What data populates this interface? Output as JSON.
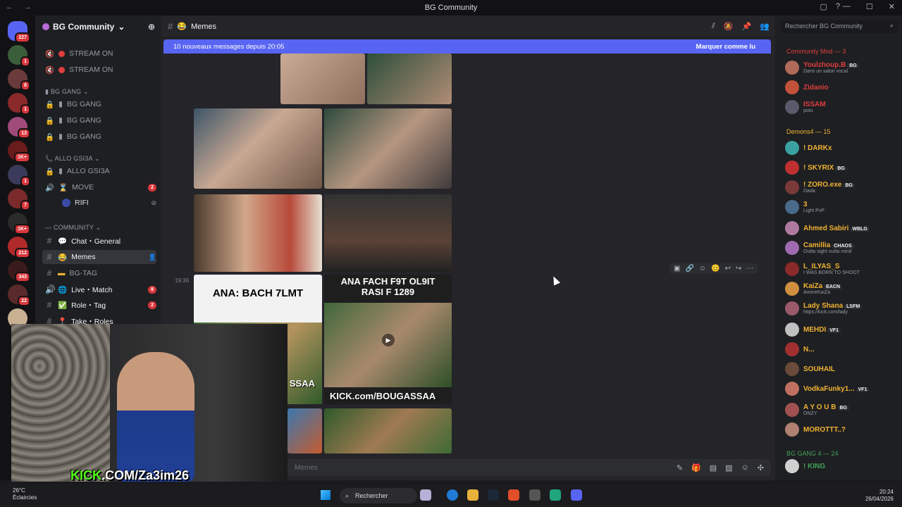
{
  "window": {
    "title": "BG Community"
  },
  "servers": [
    {
      "badge": "227"
    },
    {
      "badge": "1"
    },
    {
      "badge": "6"
    },
    {
      "badge": "1"
    },
    {
      "badge": "13"
    },
    {
      "badge": "1K+"
    },
    {
      "badge": "1"
    },
    {
      "badge": "7"
    },
    {
      "badge": "1K+"
    },
    {
      "badge": "212"
    },
    {
      "badge": "343"
    },
    {
      "badge": "22"
    },
    {
      "badge": ""
    }
  ],
  "guild": {
    "name": "BG Community"
  },
  "channels": {
    "stream1": "STREAM ON",
    "stream2": "STREAM ON",
    "cat_bg_gang": "BG GANG",
    "bg1": "BG GANG",
    "bg2": "BG GANG",
    "bg3": "BG GANG",
    "cat_allo": "ALLO GSI3A",
    "allo": "ALLO GSI3A",
    "move": "MOVE",
    "move_badge": "2",
    "rifi": "RIFI",
    "cat_community": "COMMUNITY",
    "chat": "Chat・General",
    "memes": "Memes",
    "bgtag": "BG-TAG",
    "live": "Live・Match",
    "live_badge": "8",
    "role": "Role・Tag",
    "role_badge": "2",
    "take": "Take・Roles"
  },
  "chat": {
    "channel_name": "Memes",
    "banner_text": "10 nouveaux messages depuis 20:05",
    "banner_action": "Marquer comme lu",
    "timestamp": "19:36",
    "meme_caption_1": "ANA: BACH 7LMT",
    "meme_caption_2": "ANA FACH F9T OL9IT RASI F 1289",
    "meme_caption_3": "SSAA",
    "meme_caption_4": "KICK.com/BOUGASSAA",
    "composer_placeholder": "Memes"
  },
  "members": {
    "search_placeholder": "Rechercher BG Community",
    "group1": "Community Mod — 3",
    "group2": "Demons4 — 15",
    "group3": "BG GANG 4 — 24",
    "list": [
      {
        "name": "Youlzhoup.B",
        "tag": "BG",
        "sub": "Dans un salon vocal",
        "color": "#e03e3e"
      },
      {
        "name": "Zidanio",
        "tag": "",
        "sub": "",
        "color": "#e03e3e"
      },
      {
        "name": "ISSAM",
        "tag": "",
        "sub": "poto",
        "color": "#e03e3e"
      },
      {
        "name": "! DARKx",
        "tag": "",
        "sub": "",
        "color": "#f0b232"
      },
      {
        "name": "! SKYRIX",
        "tag": "BG",
        "sub": "",
        "color": "#f0b232"
      },
      {
        "name": "! ZORO.exe",
        "tag": "BG",
        "sub": "Dada",
        "color": "#f0b232"
      },
      {
        "name": "3",
        "tag": "",
        "sub": "Light PvP",
        "color": "#f0b232"
      },
      {
        "name": "Ahmed Sabiri",
        "tag": "WBLG",
        "sub": "",
        "color": "#f0b232"
      },
      {
        "name": "Camillia",
        "tag": "CHAOS",
        "sub": "Outta sight outta mind",
        "color": "#f0b232"
      },
      {
        "name": "L_ILYAS_S",
        "tag": "",
        "sub": "I WAS BORN TO SHOOT",
        "color": "#f0b232"
      },
      {
        "name": "KaiZa",
        "tag": "EACN",
        "sub": "AmineKaiZa",
        "color": "#f0b232"
      },
      {
        "name": "Lady Shana",
        "tag": "LSFM",
        "sub": "https://kick.com/lady",
        "color": "#f0b232"
      },
      {
        "name": "MEHDI",
        "tag": "VF1",
        "sub": "",
        "color": "#f0b232"
      },
      {
        "name": "N...",
        "tag": "",
        "sub": "",
        "color": "#f0b232"
      },
      {
        "name": "SOUHAIL",
        "tag": "",
        "sub": "",
        "color": "#f0b232"
      },
      {
        "name": "VodkaFunky1...",
        "tag": "VF1",
        "sub": "",
        "color": "#f0b232"
      },
      {
        "name": "A Y O U B",
        "tag": "BG",
        "sub": "ONZY",
        "color": "#f0b232"
      },
      {
        "name": "MOROTTT..?",
        "tag": "",
        "sub": "",
        "color": "#f0b232"
      },
      {
        "name": "! KING",
        "tag": "",
        "sub": "",
        "color": "#43a25a"
      }
    ]
  },
  "webcam": {
    "kick_prefix": "KICK",
    "kick_url": ".COM/Za3im26"
  },
  "taskbar": {
    "temp": "26°C",
    "weather": "Éclaircies",
    "search": "Rechercher",
    "time": "20:24",
    "date": "26/04/2026"
  }
}
